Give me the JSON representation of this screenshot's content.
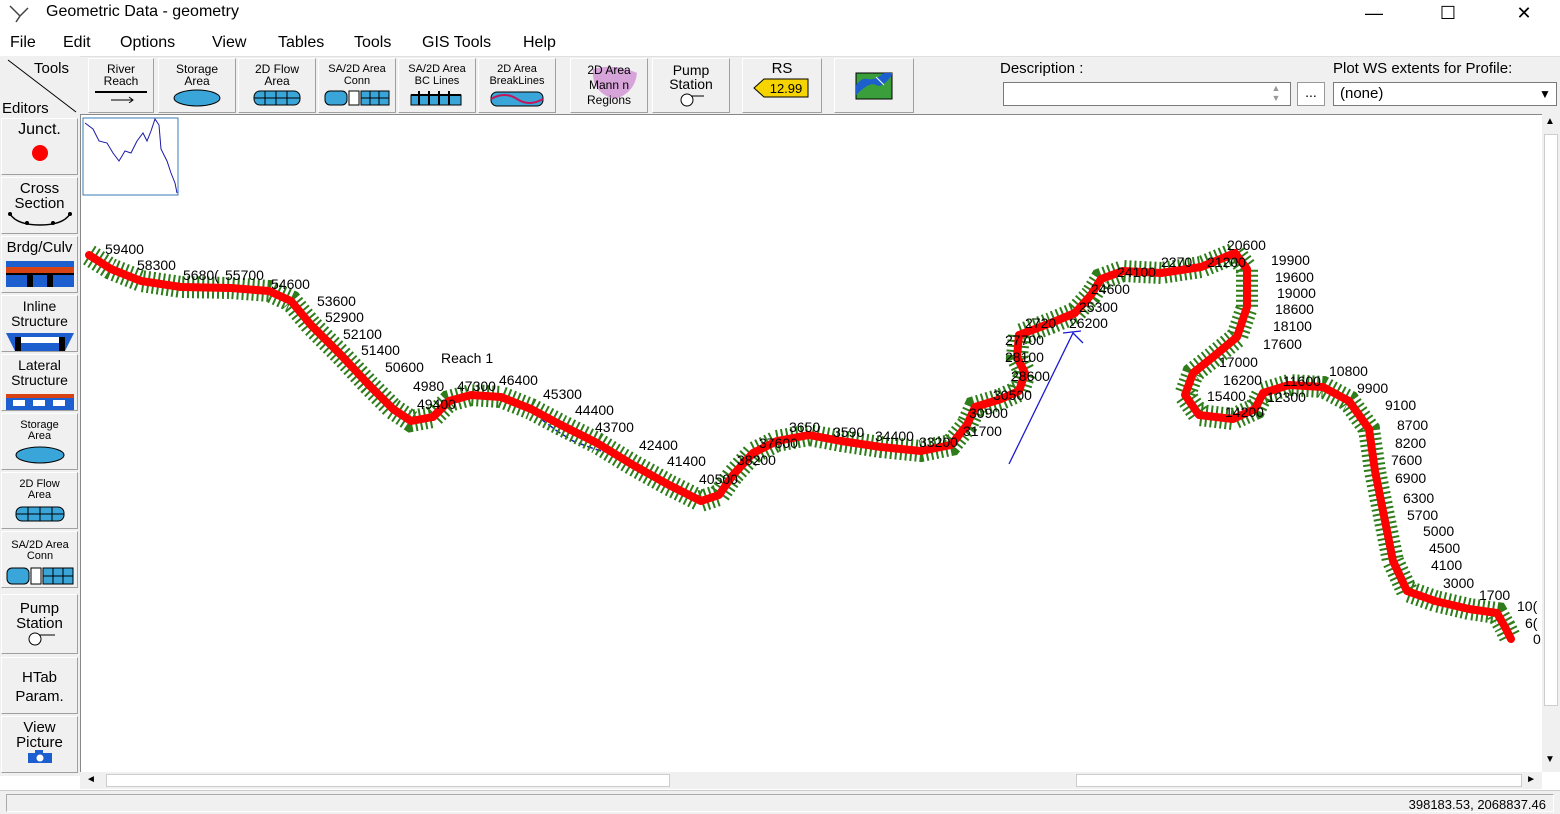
{
  "window": {
    "title": "Geometric Data - geometry",
    "minimize": "—",
    "maximize": "☐",
    "close": "✕"
  },
  "menu": [
    "File",
    "Edit",
    "Options",
    "View",
    "Tables",
    "Tools",
    "GIS Tools",
    "Help"
  ],
  "toolbar": {
    "tools_label": "Tools",
    "editors_label": "Editors",
    "river_reach": "River Reach",
    "storage_area": "Storage Area",
    "flow_area_2d": "2D Flow Area",
    "sa_2d_conn": "SA/2D Area Conn",
    "sa_2d_bc": "SA/2D Area BC Lines",
    "breaklines_2d": "2D Area BreakLines",
    "mann_regions": "2D Area Mann n Regions",
    "pump_station": "Pump Station",
    "rs_label": "RS",
    "rs_value": "12.99",
    "description_label": "Description :",
    "description_value": "",
    "more_button": "...",
    "plot_ws_label": "Plot WS extents for Profile:",
    "plot_ws_value": "(none)"
  },
  "editors": {
    "junction": "Junct.",
    "cross_section": "Cross Section",
    "bridge_culvert": "Brdg/Culv",
    "inline_structure": "Inline Structure",
    "lateral_structure": "Lateral Structure",
    "storage_area": "Storage Area",
    "flow_area_2d": "2D Flow Area",
    "sa_2d_conn": "SA/2D Area Conn",
    "pump_station": "Pump Station",
    "htab_param": "HTab Param.",
    "view_picture": "View Picture"
  },
  "map": {
    "reach_name": "Reach 1",
    "river_color": "#ff0000",
    "section_color": "#2e7d1a",
    "stations": [
      "59400",
      "58300",
      "5680(",
      "55700",
      "54600",
      "53600",
      "52900",
      "52100",
      "51400",
      "50600",
      "4980",
      "47300",
      "49400",
      "46400",
      "45300",
      "44400",
      "43700",
      "42400",
      "41400",
      "40500",
      "38200",
      "37600",
      "3650",
      "3590",
      "34400",
      "33200",
      "31700",
      "30900",
      "30500",
      "28600",
      "28100",
      "27700",
      "2720",
      "26200",
      "25300",
      "24600",
      "24100",
      "2270",
      "21200",
      "20600",
      "19900",
      "19600",
      "19000",
      "18600",
      "18100",
      "17600",
      "17000",
      "16200",
      "11600",
      "10800",
      "15400",
      "12300",
      "14200",
      "9900",
      "9100",
      "8700",
      "8200",
      "7600",
      "6900",
      "6300",
      "5700",
      "5000",
      "4500",
      "4100",
      "3000",
      "1700",
      "10(",
      "6(",
      "0"
    ]
  },
  "status": {
    "coords": "398183.53, 2068837.46"
  }
}
